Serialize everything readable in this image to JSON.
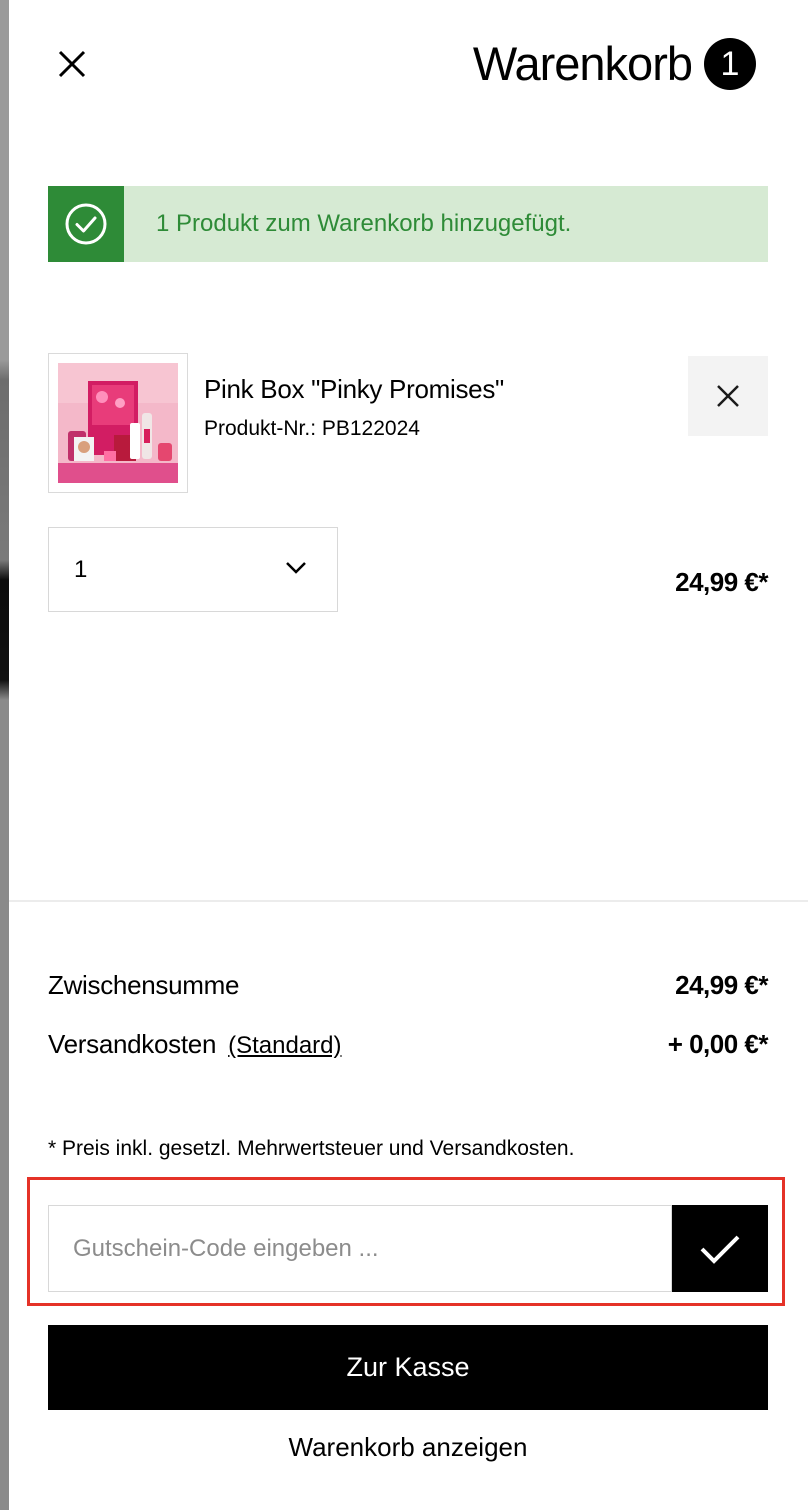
{
  "header": {
    "close_icon": "close-icon",
    "title": "Warenkorb",
    "item_count": "1"
  },
  "notification": {
    "icon": "check-circle-icon",
    "message": "1 Produkt zum Warenkorb hinzugefügt.",
    "colors": {
      "text": "#2e8b37",
      "background": "#d6ead3",
      "icon_background": "#2e8b37"
    }
  },
  "cart_item": {
    "name": "Pink Box \"Pinky Promises\"",
    "product_number": "Produkt-Nr.: PB122024",
    "remove_icon": "close-icon",
    "quantity": "1",
    "price": "24,99 €*"
  },
  "summary": {
    "subtotal_label": "Zwischensumme",
    "subtotal_value": "24,99 €*",
    "shipping_label": "Versandkosten",
    "shipping_method": "(Standard)",
    "shipping_value": "+ 0,00 €*",
    "tax_note": "* Preis inkl. gesetzl. Mehrwertsteuer und Versandkosten."
  },
  "voucher": {
    "placeholder": "Gutschein-Code eingeben ...",
    "submit_icon": "checkmark-icon",
    "highlight_color": "#e53228"
  },
  "actions": {
    "checkout_label": "Zur Kasse",
    "view_cart_label": "Warenkorb anzeigen"
  }
}
